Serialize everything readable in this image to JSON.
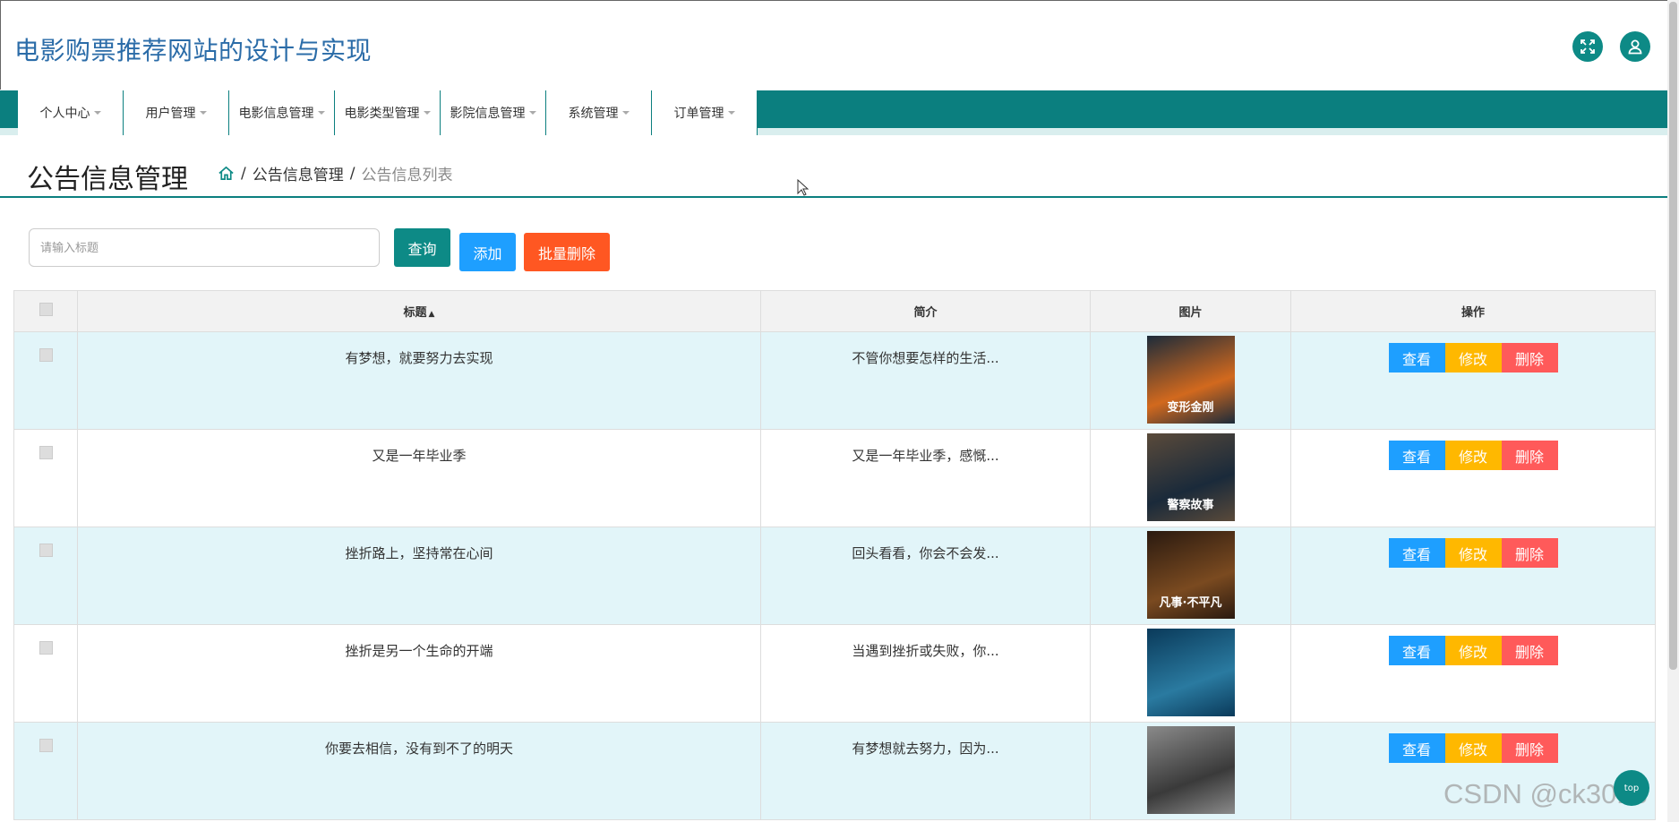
{
  "site": {
    "title": "电影购票推荐网站的设计与实现",
    "fullscreen_icon": "fullscreen-icon",
    "user_icon": "user-icon"
  },
  "nav": {
    "items": [
      {
        "label": "个人中心"
      },
      {
        "label": "用户管理"
      },
      {
        "label": "电影信息管理"
      },
      {
        "label": "电影类型管理"
      },
      {
        "label": "影院信息管理"
      },
      {
        "label": "系统管理"
      },
      {
        "label": "订单管理"
      }
    ]
  },
  "page": {
    "title": "公告信息管理",
    "breadcrumb": [
      "公告信息管理",
      "公告信息列表"
    ],
    "home_icon": "home-icon"
  },
  "search": {
    "placeholder": "请输入标题",
    "query_label": "查询",
    "add_label": "添加",
    "batch_delete_label": "批量删除"
  },
  "table": {
    "columns": [
      "",
      "标题",
      "简介",
      "图片",
      "操作"
    ],
    "sort_icon": "sort-icon",
    "rows": [
      {
        "title": "有梦想，就要努力去实现",
        "summary": "不管你想要怎样的生活...",
        "poster_text": "变形金刚",
        "poster_colors": [
          "#1c2b3a",
          "#d2691e"
        ]
      },
      {
        "title": "又是一年毕业季",
        "summary": "又是一年毕业季，感慨...",
        "poster_text": "警察故事",
        "poster_colors": [
          "#5a4a3a",
          "#1a2a3a"
        ]
      },
      {
        "title": "挫折路上，坚持常在心间",
        "summary": "回头看看，你会不会发...",
        "poster_text": "凡事·不平凡",
        "poster_colors": [
          "#2a1a10",
          "#7a4a20"
        ]
      },
      {
        "title": "挫折是另一个生命的开端",
        "summary": "当遇到挫折或失败，你...",
        "poster_text": "",
        "poster_colors": [
          "#0a3a5a",
          "#2a7aa0"
        ]
      },
      {
        "title": "你要去相信，没有到不了的明天",
        "summary": "有梦想就去努力，因为...",
        "poster_text": "",
        "poster_colors": [
          "#8a8a8a",
          "#3a3a3a"
        ]
      }
    ],
    "actions": {
      "view": "查看",
      "edit": "修改",
      "delete": "删除"
    }
  },
  "watermark": "CSDN @ck3013",
  "fab_label": "top"
}
